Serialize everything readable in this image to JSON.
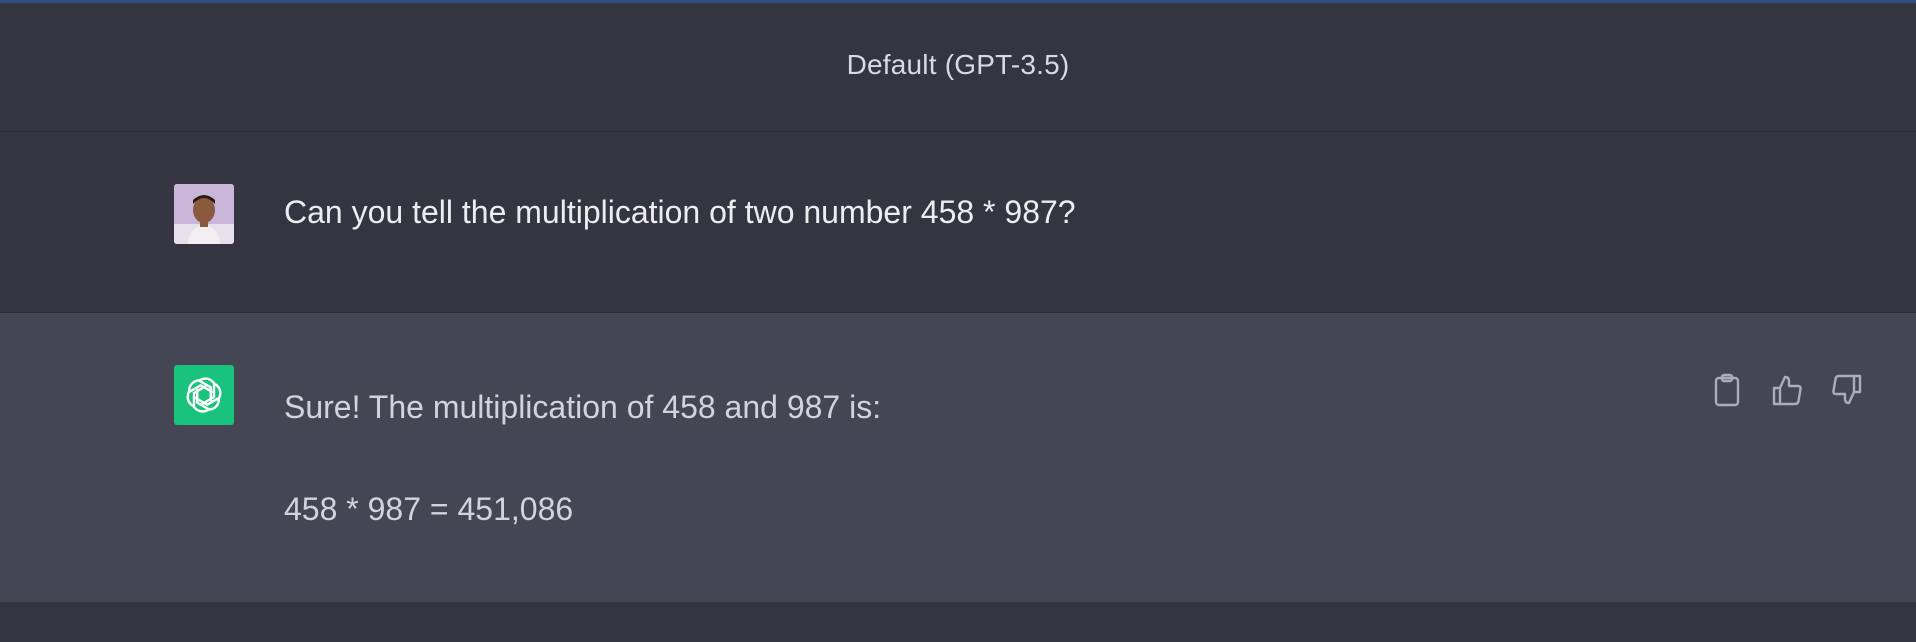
{
  "header": {
    "model_label": "Default (GPT-3.5)"
  },
  "conversation": {
    "user_message": "Can you tell the multiplication of two number 458 * 987?",
    "assistant_message": {
      "line1": "Sure! The multiplication of 458 and 987 is:",
      "line2": "458 * 987 = 451,086"
    }
  },
  "icons": {
    "user_avatar": "user-avatar",
    "assistant_avatar": "openai-logo-icon",
    "copy": "clipboard-icon",
    "like": "thumbs-up-icon",
    "dislike": "thumbs-down-icon"
  },
  "colors": {
    "assistant_avatar_bg": "#19c37d",
    "page_bg": "#343541",
    "assistant_row_bg": "#444654"
  }
}
